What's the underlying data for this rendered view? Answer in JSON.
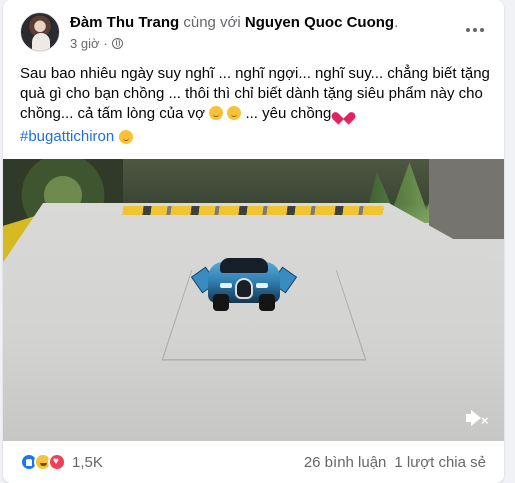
{
  "post": {
    "author": "Đàm Thu Trang",
    "with_text": "cùng với",
    "tagged_user": "Nguyen Quoc Cuong",
    "time": "3 giờ",
    "caption_line_1": "Sau bao nhiêu ngày suy nghĩ ... nghĩ ngợi... nghĩ suy... chẳng biết tặng",
    "caption_line_2": "quà gì cho bạn chồng ... thôi thì chỉ biết dành tặng siêu phẩm này cho",
    "caption_line_3": "chồng... cả tấm lòng của vợ",
    "caption_line_4": "... yêu chồng",
    "hashtag": "#bugattichiron",
    "icons": {
      "privacy": "globe-icon",
      "more": "more-icon",
      "mute": "mute-icon",
      "caption_emoji": "smiling-face-icon",
      "love": "red-heart-icon"
    }
  },
  "engagement": {
    "reactions_count": "1,5K",
    "comments": "26 bình luận",
    "shares": "1 lượt chia sẻ"
  },
  "colors": {
    "link": "#216fdb",
    "text": "#050505",
    "secondary": "#65676b",
    "like": "#1877f2",
    "love": "#f33e58",
    "haha": "#f7c23a"
  }
}
